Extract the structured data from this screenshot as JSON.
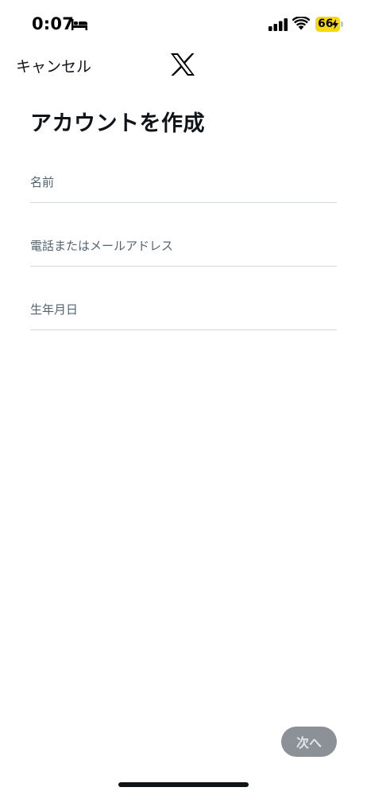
{
  "status_bar": {
    "time": "0:07",
    "battery_level": "66",
    "battery_color": "#f5d90a",
    "icons": [
      "bed-icon",
      "signal-icon",
      "wifi-icon",
      "battery-charging-icon"
    ]
  },
  "header": {
    "cancel_label": "キャンセル",
    "logo_icon": "x-logo-icon"
  },
  "title": "アカウントを作成",
  "form": {
    "name": {
      "placeholder": "名前",
      "value": ""
    },
    "contact": {
      "placeholder": "電話またはメールアドレス",
      "value": ""
    },
    "birthday": {
      "placeholder": "生年月日",
      "value": ""
    }
  },
  "footer": {
    "next_label": "次へ",
    "next_enabled": false
  }
}
